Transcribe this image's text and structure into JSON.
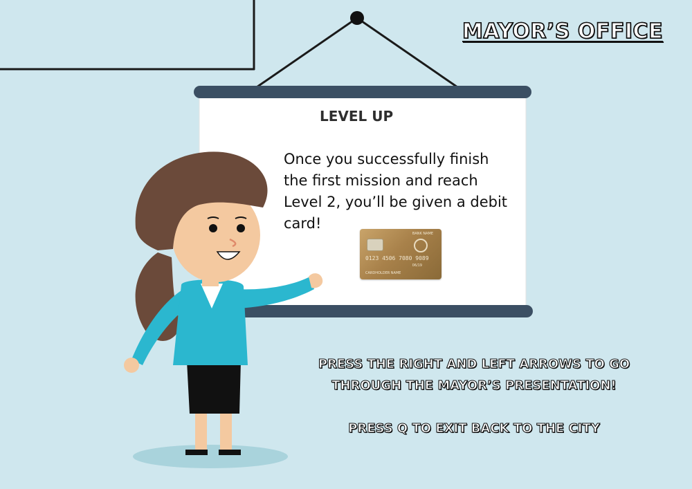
{
  "header": {
    "title": "Mayor’s Office"
  },
  "board": {
    "heading": "LEVEL UP",
    "lines": [
      "Once you successfully finish",
      "the first mission and reach",
      "Level 2, you’ll be given a debit",
      "card!"
    ]
  },
  "card": {
    "bank_name": "BANK NAME",
    "number": "0123 4506 7080 9089",
    "expiry": "06/19",
    "holder": "CARDHOLDER NAME"
  },
  "instructions": {
    "line1": "Press the right and left arrows to go",
    "line2": "through the mayor’s presentation!",
    "exit": "Press Q to exit back to the city"
  },
  "colors": {
    "background": "#cfe7ee",
    "screen_bar": "#3b4f63",
    "shirt": "#2bb7cf",
    "hair": "#6b4a3a"
  },
  "icons": [
    "credit-card-icon",
    "mayor-character-icon"
  ]
}
